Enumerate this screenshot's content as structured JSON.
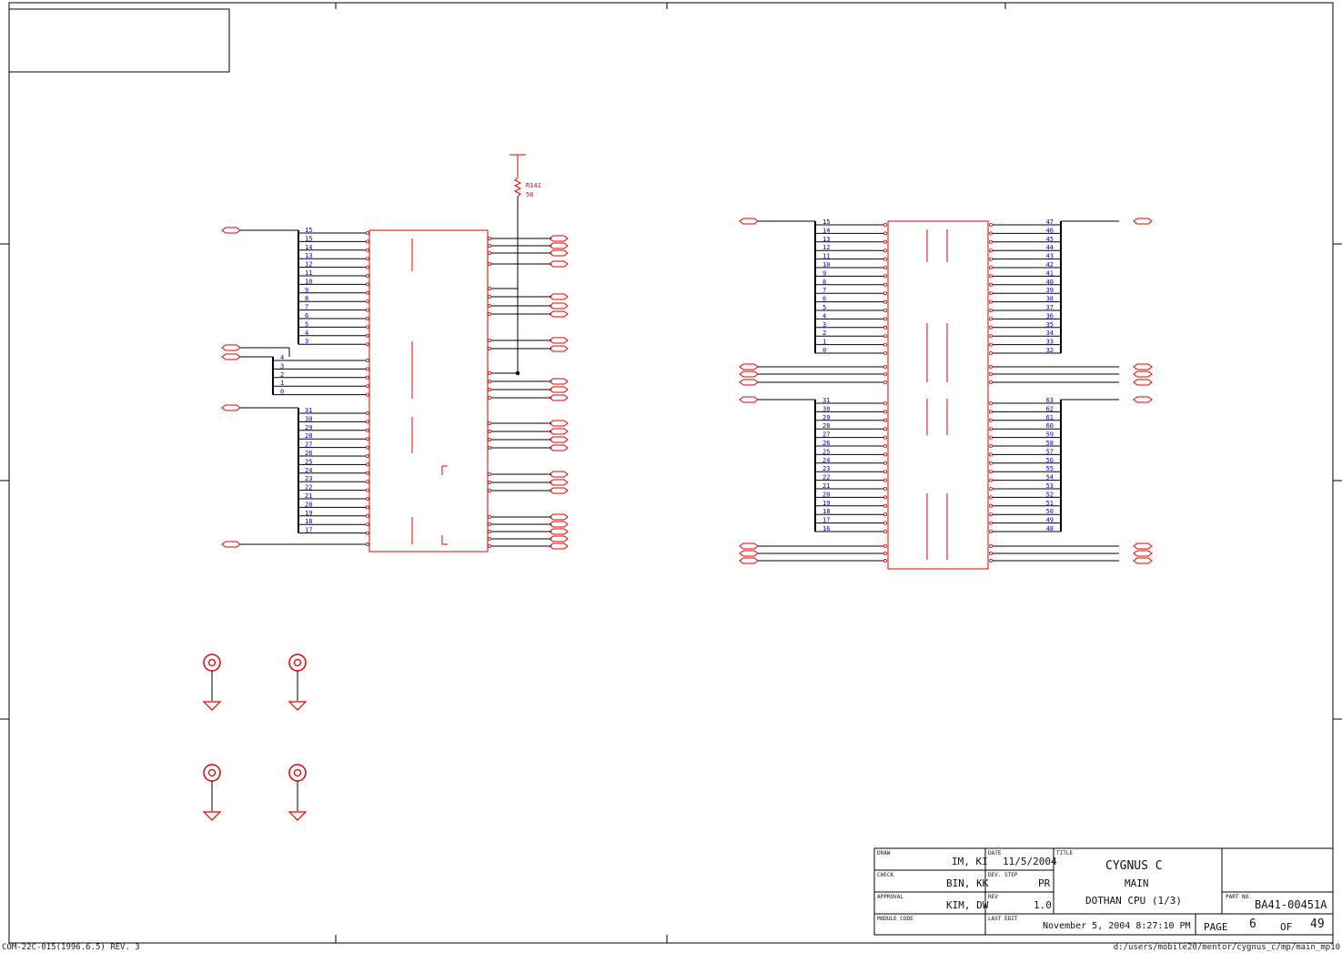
{
  "title_block": {
    "draw_label": "DRAW",
    "draw_value": "IM, KI",
    "date_label": "DATE",
    "date_value": "11/5/2004",
    "title_label": "TITLE",
    "title_lines": [
      "CYGNUS C",
      "MAIN",
      "DOTHAN CPU (1/3)"
    ],
    "check_label": "CHECK",
    "check_value": "BIN, KK",
    "devstep_label": "DEV. STEP",
    "devstep_value": "PR",
    "approval_label": "APPROVAL",
    "approval_value": "KIM, DW",
    "rev_label": "REV",
    "rev_value": "1.0",
    "partno_label": "PART NO.",
    "partno_value": "BA41-00451A",
    "module_label": "MODULE CODE",
    "lastedit_label": "LAST EDIT",
    "lastedit_value": "November 5, 2004  8:27:10 PM",
    "page_label": "PAGE",
    "page_value": "6",
    "of_label": "OF",
    "total_pages": "49"
  },
  "footer": {
    "left": "COM-22C-015(1996.6.5) REV. 3",
    "right": "d:/users/mobile20/mentor/cygnus_c/mp/main_mp10"
  },
  "resistor": {
    "ref": "R141",
    "value": "56"
  },
  "left_bus": {
    "upper_pins": [
      "15",
      "15",
      "14",
      "13",
      "12",
      "11",
      "10",
      "9",
      "8",
      "7",
      "6",
      "5",
      "4",
      "3"
    ],
    "small_pins": [
      "4",
      "3",
      "2",
      "1",
      "0"
    ],
    "lower_pins": [
      "31",
      "30",
      "29",
      "28",
      "27",
      "26",
      "25",
      "24",
      "23",
      "22",
      "21",
      "20",
      "19",
      "18",
      "17"
    ]
  },
  "right_bus": {
    "left_upper_pins": [
      "15",
      "14",
      "13",
      "12",
      "11",
      "10",
      "9",
      "8",
      "7",
      "6",
      "5",
      "4",
      "3",
      "2",
      "1",
      "0"
    ],
    "right_upper_pins": [
      "47",
      "46",
      "45",
      "44",
      "43",
      "42",
      "41",
      "40",
      "39",
      "38",
      "37",
      "36",
      "35",
      "34",
      "33",
      "32"
    ],
    "left_lower_pins": [
      "31",
      "30",
      "29",
      "28",
      "27",
      "26",
      "25",
      "24",
      "23",
      "22",
      "21",
      "20",
      "19",
      "18",
      "17",
      "16"
    ],
    "right_lower_pins": [
      "63",
      "62",
      "61",
      "60",
      "59",
      "58",
      "57",
      "56",
      "55",
      "54",
      "53",
      "52",
      "51",
      "50",
      "49",
      "48"
    ]
  },
  "colors": {
    "wire": "#000000",
    "part": "#e00000",
    "pin_label": "#0000cc",
    "frame": "#000000"
  }
}
